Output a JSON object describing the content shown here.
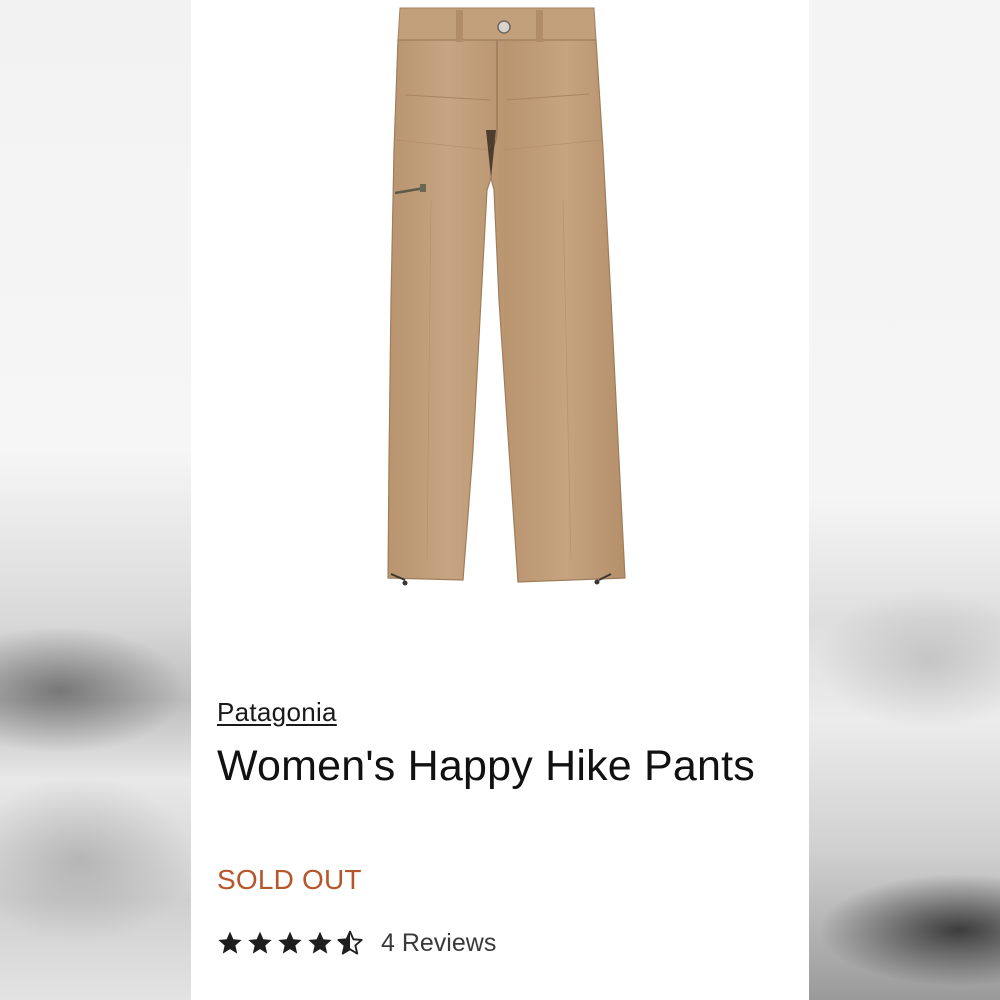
{
  "product": {
    "brand": "Patagonia",
    "title": "Women's Happy Hike Pants",
    "status": "SOLD OUT",
    "rating": {
      "value": 4.5,
      "max": 5,
      "reviews_label": "4 Reviews"
    },
    "image": {
      "icon": "pants-product-image",
      "color": "#c4a27f"
    }
  },
  "colors": {
    "status": "#b5562b",
    "text": "#111111",
    "star": "#1e1e1e",
    "background": "#ffffff"
  }
}
